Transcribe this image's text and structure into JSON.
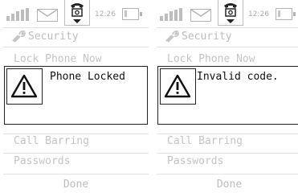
{
  "screens": [
    {
      "status": {
        "time": "12:26"
      },
      "header": {
        "title": "Security",
        "icon": "wrench-icon"
      },
      "menu": {
        "item_top": "Lock Phone Now",
        "items_bottom": [
          "Call Barring",
          "Passwords"
        ]
      },
      "dialog": {
        "message": "Phone Locked",
        "icon": "warning-icon"
      },
      "footer": {
        "done_label": "Done"
      }
    },
    {
      "status": {
        "time": "12:26"
      },
      "header": {
        "title": "Security",
        "icon": "wrench-icon"
      },
      "menu": {
        "item_top": "Lock Phone Now",
        "items_bottom": [
          "Call Barring",
          "Passwords"
        ]
      },
      "dialog": {
        "message": "Invalid code.",
        "icon": "warning-icon"
      },
      "footer": {
        "done_label": "Done"
      }
    }
  ],
  "colors": {
    "dimmed_text": "#c4c4c4",
    "dialog_border": "#222222",
    "divider": "#e2e2e2"
  }
}
